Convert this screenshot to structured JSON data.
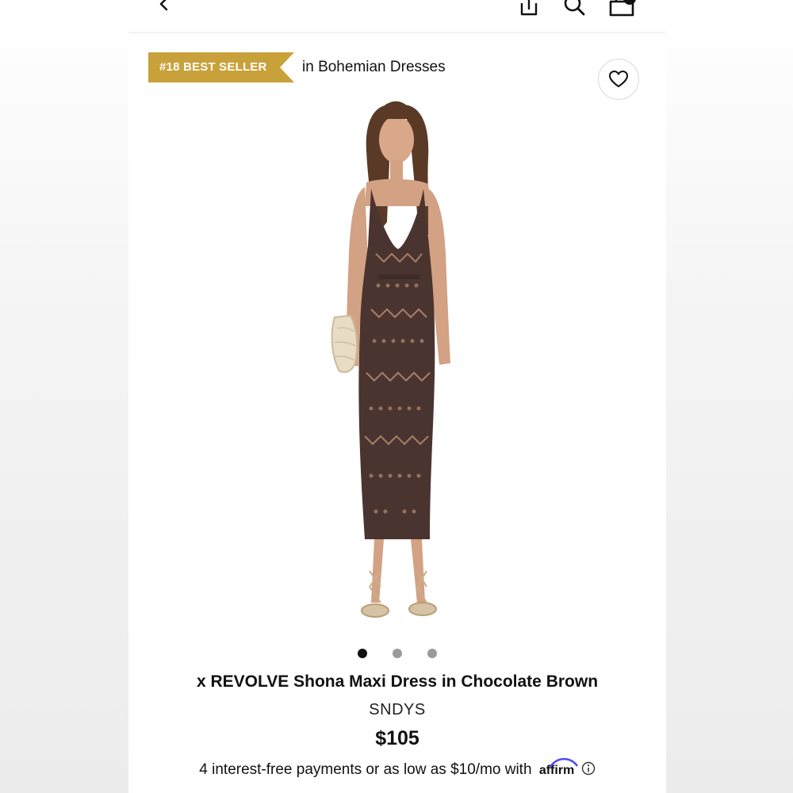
{
  "badge": {
    "label": "#18 BEST SELLER",
    "category": "in Bohemian Dresses",
    "color": "#C9A13A"
  },
  "icons": {
    "back": "chevron-left-icon",
    "share": "share-icon",
    "search": "search-icon",
    "bag": "shopping-bag-icon",
    "wishlist": "heart-icon",
    "info": "info-icon"
  },
  "carousel": {
    "total": 3,
    "active_index": 0
  },
  "product": {
    "title": "x REVOLVE Shona Maxi Dress in Chocolate Brown",
    "brand": "SNDYS",
    "price": "$105",
    "payments_text": "4 interest-free payments or as low as $10/mo with",
    "affirm_label": "affirm",
    "dress_color": "#4a3430"
  }
}
